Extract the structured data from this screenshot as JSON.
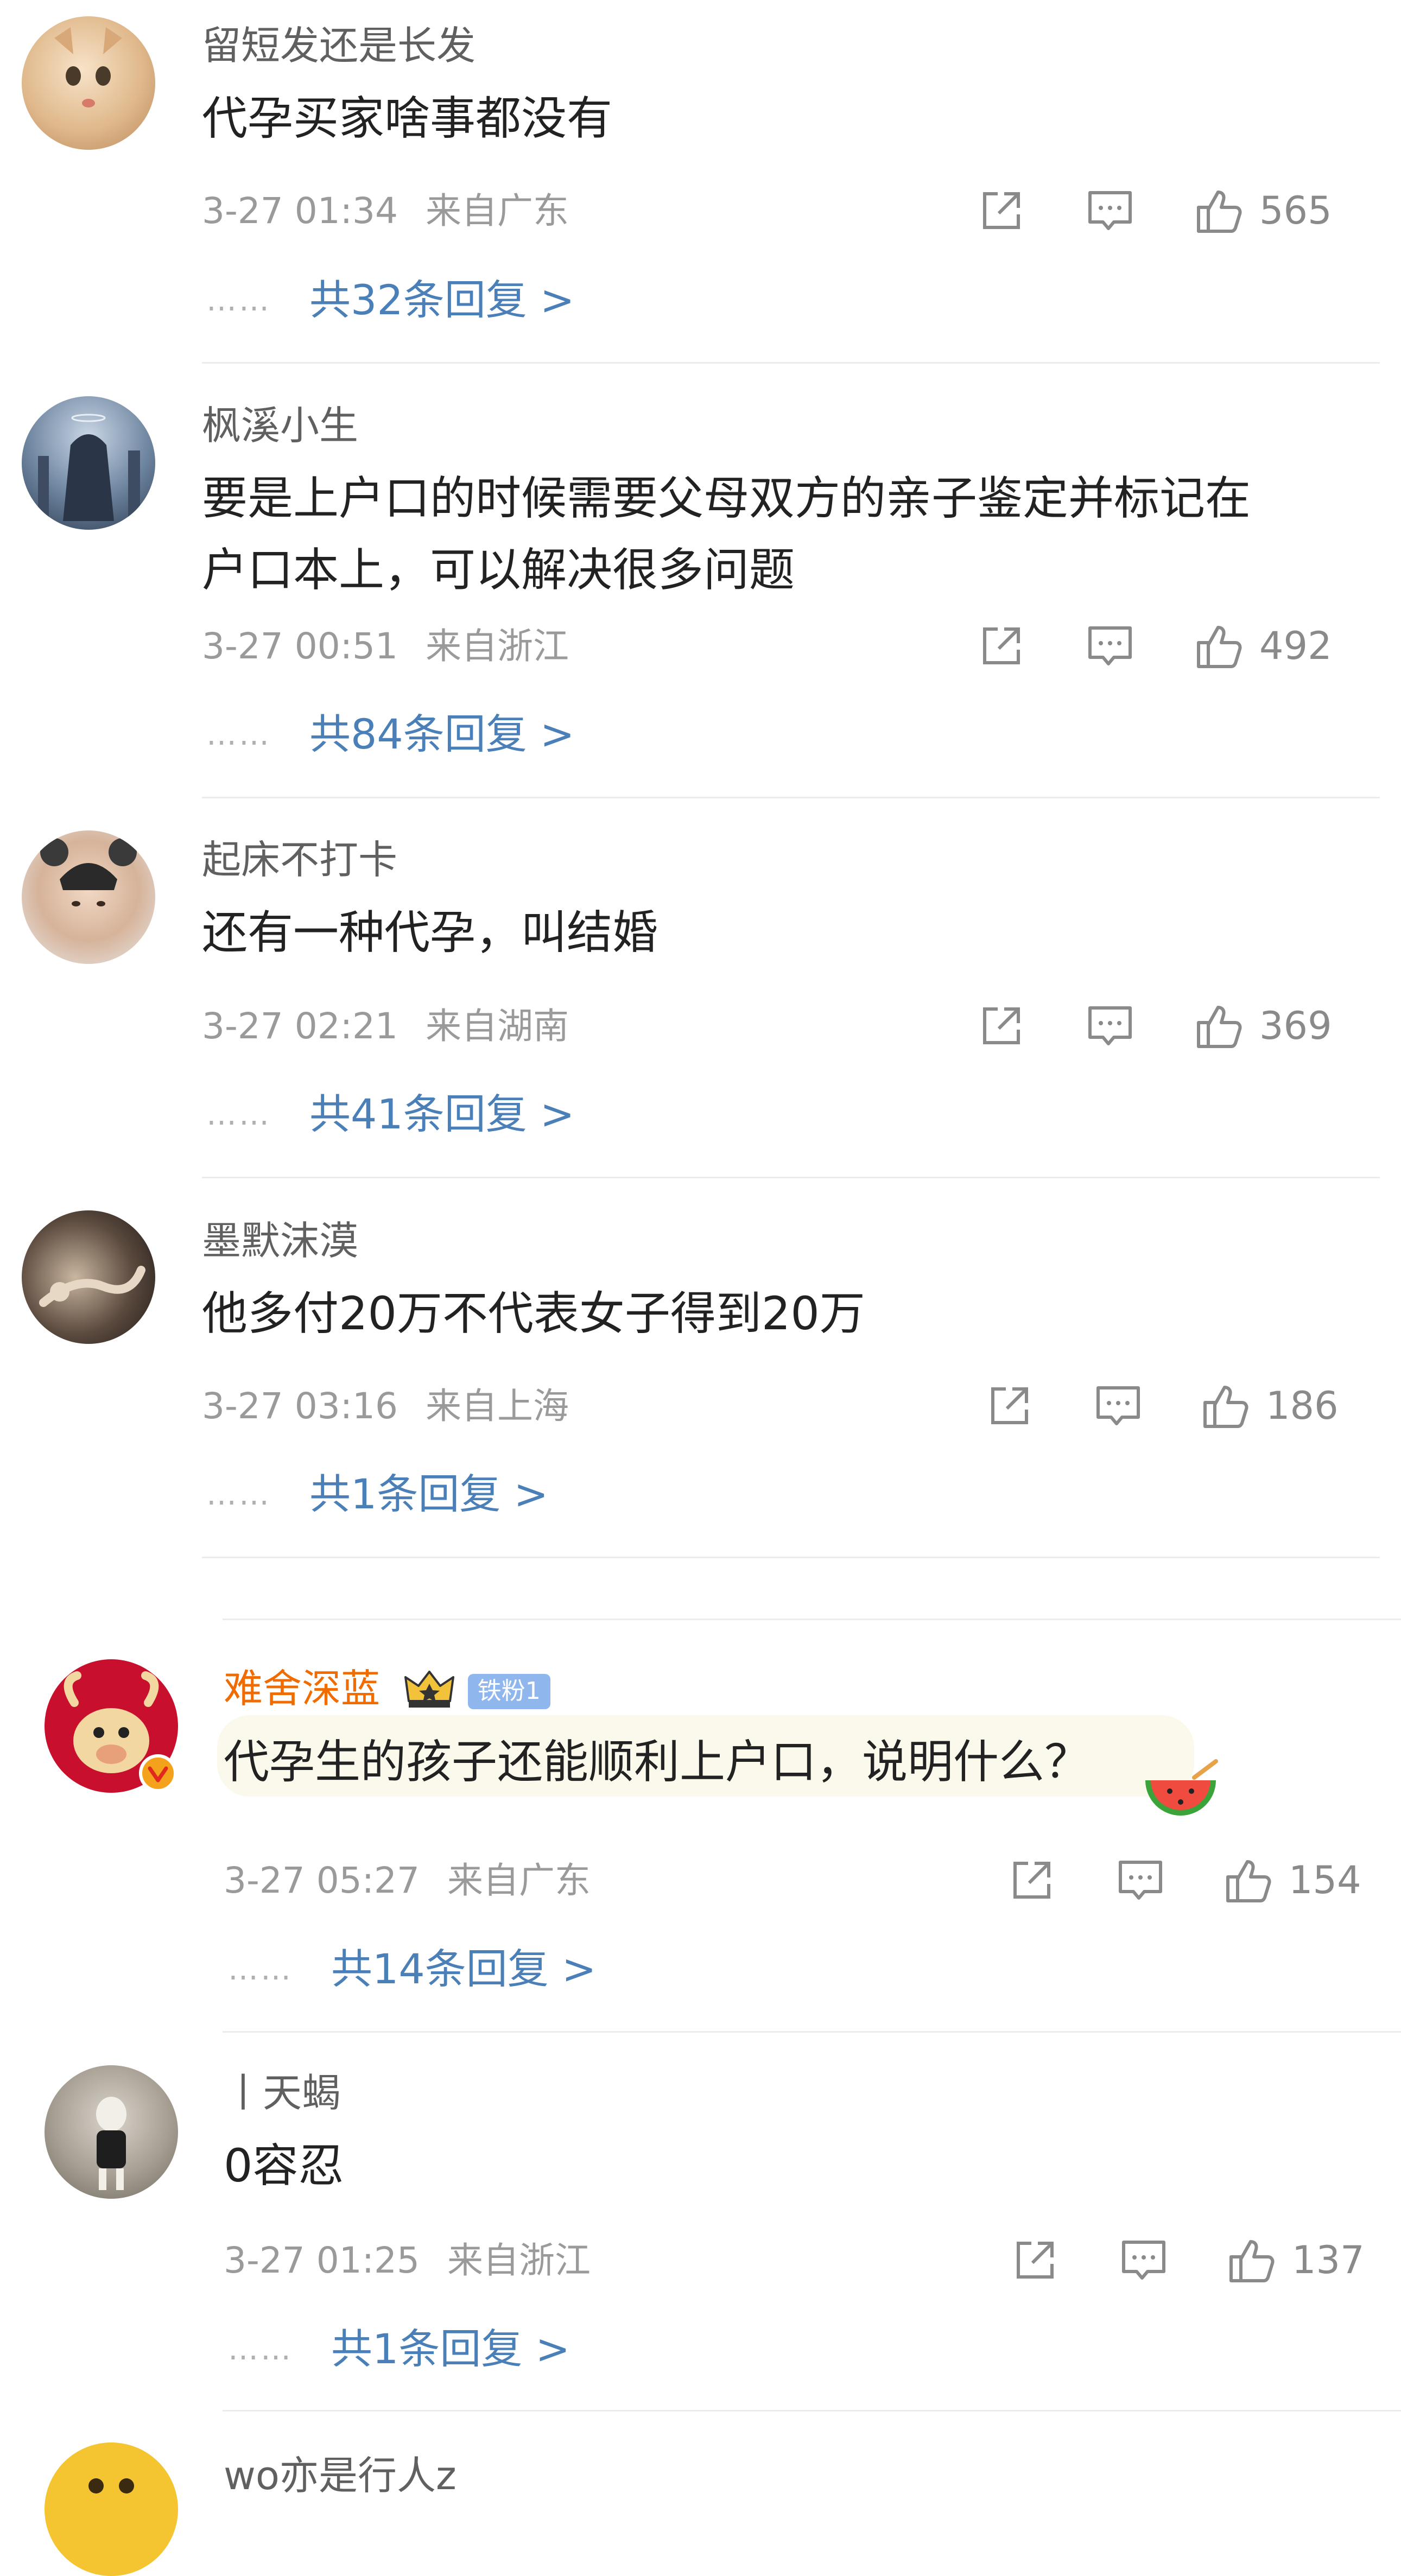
{
  "ui": {
    "reply_arrow": ">",
    "dots": "……"
  },
  "comments": [
    {
      "username": "留短发还是长发",
      "content_lines": [
        "代孕买家啥事都没有"
      ],
      "time": "3-27 01:34",
      "location": "来自广东",
      "likes": "565",
      "reply_text": "共32条回复 >"
    },
    {
      "username": "枫溪小生",
      "content_lines": [
        "要是上户口的时候需要父母双方的亲子鉴定并标记在",
        "户口本上，可以解决很多问题"
      ],
      "time": "3-27 00:51",
      "location": "来自浙江",
      "likes": "492",
      "reply_text": "共84条回复 >"
    },
    {
      "username": "起床不打卡",
      "content_lines": [
        "还有一种代孕，叫结婚"
      ],
      "time": "3-27 02:21",
      "location": "来自湖南",
      "likes": "369",
      "reply_text": "共41条回复 >"
    },
    {
      "username": "墨默沫漠",
      "content_lines": [
        "他多付20万不代表女子得到20万"
      ],
      "time": "3-27 03:16",
      "location": "来自上海",
      "likes": "186",
      "reply_text": "共1条回复 >"
    },
    {
      "username": "难舍深蓝",
      "fan_badge": "铁粉1",
      "content_lines": [
        "代孕生的孩子还能顺利上户口，说明什么？"
      ],
      "time": "3-27 05:27",
      "location": "来自广东",
      "likes": "154",
      "reply_text": "共14条回复 >"
    },
    {
      "username": "丨天蝎",
      "content_lines": [
        "0容忍"
      ],
      "time": "3-27 01:25",
      "location": "来自浙江",
      "likes": "137",
      "reply_text": "共1条回复 >"
    },
    {
      "username": "wo亦是行人z"
    }
  ]
}
